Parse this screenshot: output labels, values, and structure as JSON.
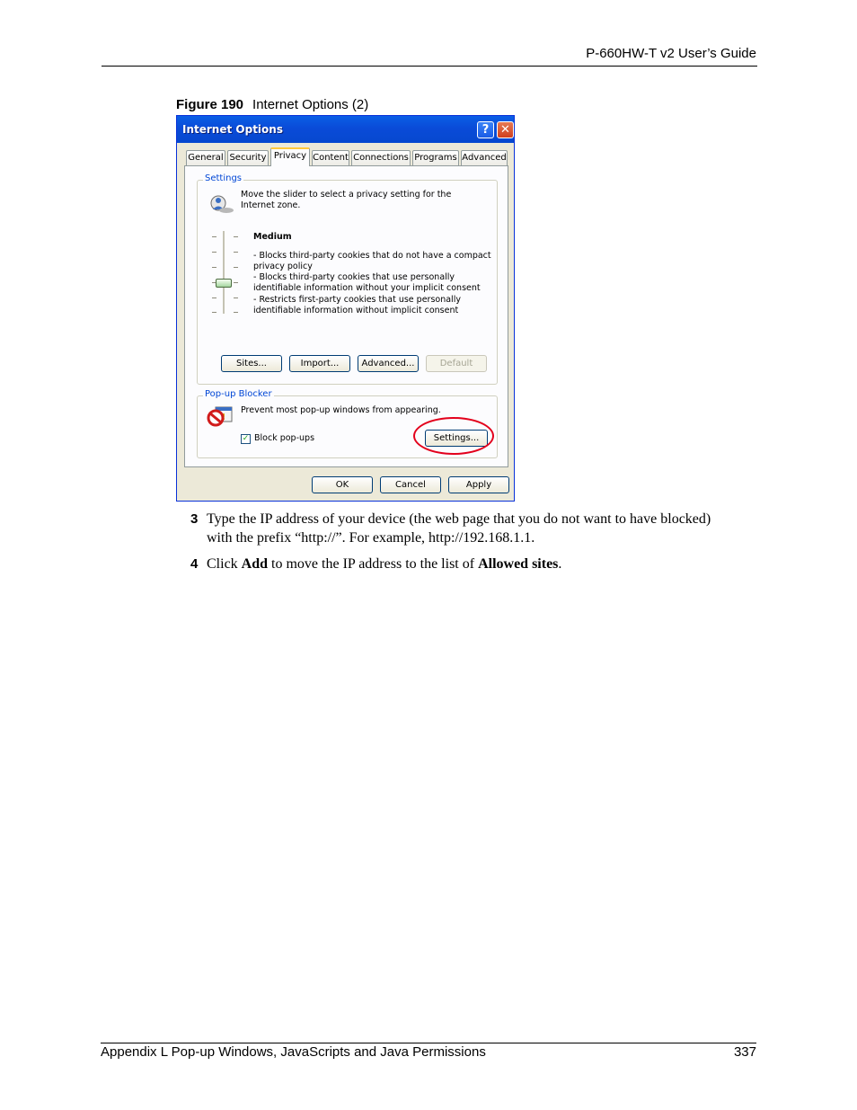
{
  "header": {
    "title": "P-660HW-T v2 User’s Guide"
  },
  "figure": {
    "label": "Figure 190",
    "caption": "Internet Options (2)"
  },
  "dialog": {
    "title": "Internet Options",
    "help_glyph": "?",
    "close_glyph": "✕",
    "tabs": [
      "General",
      "Security",
      "Privacy",
      "Content",
      "Connections",
      "Programs",
      "Advanced"
    ],
    "active_tab": "Privacy",
    "settings": {
      "label": "Settings",
      "intro": "Move the slider to select a privacy setting for the Internet zone.",
      "level": "Medium",
      "bullets": [
        "- Blocks third-party cookies that do not have a compact privacy policy",
        "- Blocks third-party cookies that use personally identifiable information without your implicit consent",
        "- Restricts first-party cookies that use personally identifiable information without implicit consent"
      ],
      "buttons": {
        "sites": "Sites...",
        "import": "Import...",
        "advanced": "Advanced...",
        "default": "Default"
      }
    },
    "popup_blocker": {
      "label": "Pop-up Blocker",
      "description": "Prevent most pop-up windows from appearing.",
      "checkbox_label": "Block pop-ups",
      "checked": true,
      "check_glyph": "✓",
      "settings_button": "Settings..."
    },
    "footer_buttons": {
      "ok": "OK",
      "cancel": "Cancel",
      "apply": "Apply"
    }
  },
  "steps": [
    {
      "num": "3",
      "line1": "Type the IP address of your device (the web page that you do not want to have blocked)",
      "line2": "with the prefix “http://”. For example, http://192.168.1.1."
    },
    {
      "num": "4",
      "pre": "Click ",
      "bold1": "Add",
      "mid": " to move the IP address to the list of ",
      "bold2": "Allowed sites",
      "post": "."
    }
  ],
  "footer": {
    "left": "Appendix L Pop-up Windows, JavaScripts and Java Permissions",
    "page": "337"
  }
}
